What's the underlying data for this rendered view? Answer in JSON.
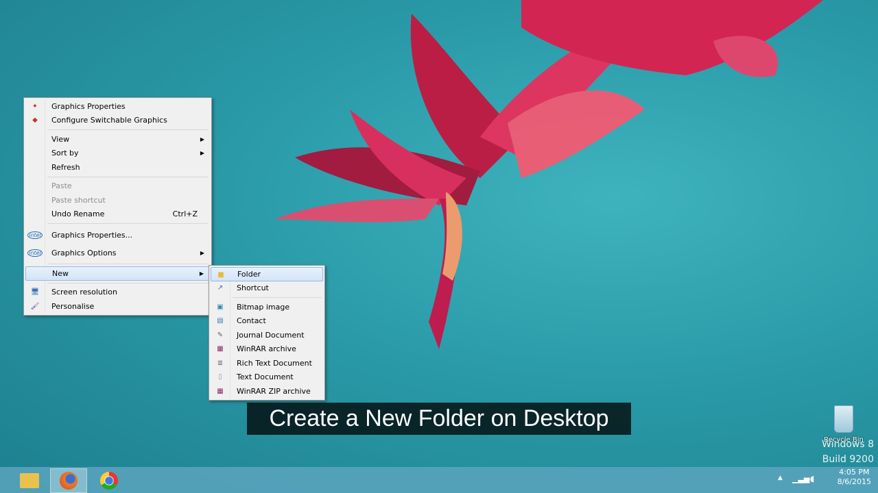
{
  "context_menu": {
    "items": [
      {
        "label": "Graphics Properties",
        "icon": "graphics-icon"
      },
      {
        "label": "Configure Switchable Graphics",
        "icon": "switchable-graphics-icon"
      },
      {
        "label": "View",
        "submenu": true
      },
      {
        "label": "Sort by",
        "submenu": true
      },
      {
        "label": "Refresh"
      },
      {
        "label": "Paste",
        "disabled": true
      },
      {
        "label": "Paste shortcut",
        "disabled": true
      },
      {
        "label": "Undo Rename",
        "shortcut": "Ctrl+Z"
      },
      {
        "label": "Graphics Properties...",
        "icon": "intel"
      },
      {
        "label": "Graphics Options",
        "icon": "intel",
        "submenu": true
      },
      {
        "label": "New",
        "submenu": true,
        "highlighted": true
      },
      {
        "label": "Screen resolution"
      },
      {
        "label": "Personalise"
      }
    ]
  },
  "intel_text": "intel",
  "new_submenu": {
    "items": [
      {
        "label": "Folder"
      },
      {
        "label": "Shortcut"
      },
      {
        "label": "Bitmap image"
      },
      {
        "label": "Contact"
      },
      {
        "label": "Journal Document"
      },
      {
        "label": "WinRAR archive"
      },
      {
        "label": "Rich Text Document"
      },
      {
        "label": "Text Document"
      },
      {
        "label": "WinRAR ZIP archive"
      }
    ]
  },
  "caption": "Create a New Folder on Desktop",
  "desktop": {
    "recycle_bin": "Recycle Bin",
    "watermark_line1": "Windows 8",
    "watermark_line2": "Build 9200"
  },
  "tray": {
    "time": "4:05 PM",
    "date": "8/6/2015"
  }
}
